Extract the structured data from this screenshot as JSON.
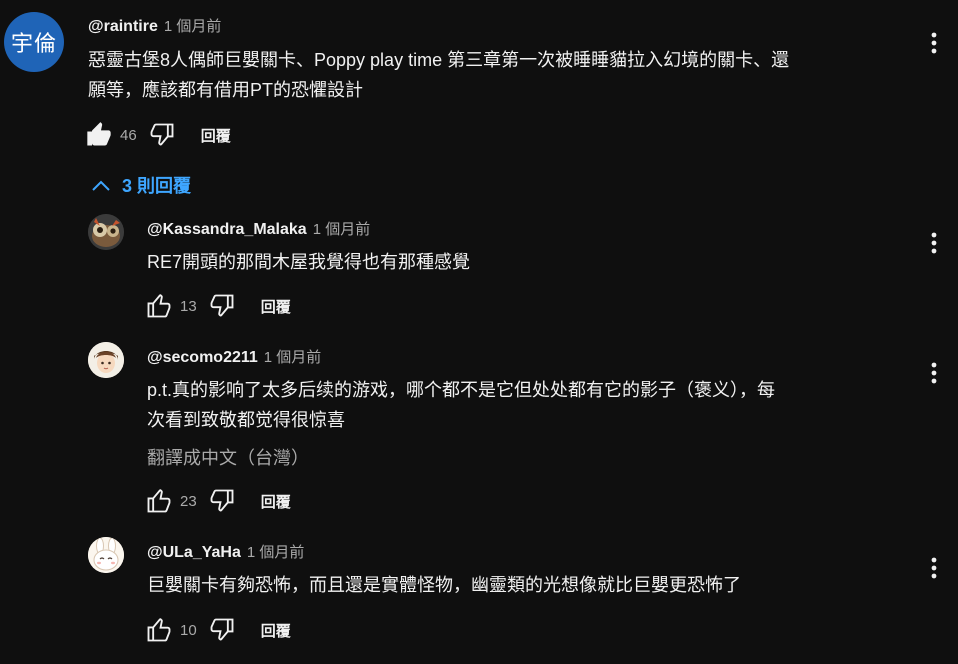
{
  "main_comment": {
    "avatar_text": "宇倫",
    "author": "@raintire",
    "time": "1 個月前",
    "lines": [
      "惡靈古堡8人偶師巨嬰關卡、Poppy play time 第三章第一次被睡睡貓拉入幻境的關卡、還",
      "願等，應該都有借用PT的恐懼設計"
    ],
    "likes": "46",
    "reply_label": "回覆"
  },
  "replies_toggle": {
    "label": "3 則回覆",
    "icon": "chevron-up-icon"
  },
  "replies": [
    {
      "author": "@Kassandra_Malaka",
      "time": "1 個月前",
      "lines": [
        "RE7開頭的那間木屋我覺得也有那種感覺"
      ],
      "likes": "13",
      "reply_label": "回覆"
    },
    {
      "author": "@secomo2211",
      "time": "1 個月前",
      "lines": [
        "p.t.真的影响了太多后续的游戏，哪个都不是它但处处都有它的影子（褒义），每",
        "次看到致敬都觉得很惊喜"
      ],
      "translate_label": "翻譯成中文（台灣）",
      "likes": "23",
      "reply_label": "回覆"
    },
    {
      "author": "@ULa_YaHa",
      "time": "1 個月前",
      "lines": [
        "巨嬰關卡有夠恐怖，而且還是實體怪物，幽靈類的光想像就比巨嬰更恐怖了"
      ],
      "likes": "10",
      "reply_label": "回覆"
    }
  ],
  "colors": {
    "background": "#0f0f0f",
    "link_blue": "#3ea6ff",
    "text": "#f1f1f1",
    "muted": "#aaaaaa",
    "avatar_blue": "#1f64b7"
  },
  "icons": [
    "like-icon",
    "dislike-icon",
    "more-vert-icon",
    "chevron-up-icon"
  ]
}
